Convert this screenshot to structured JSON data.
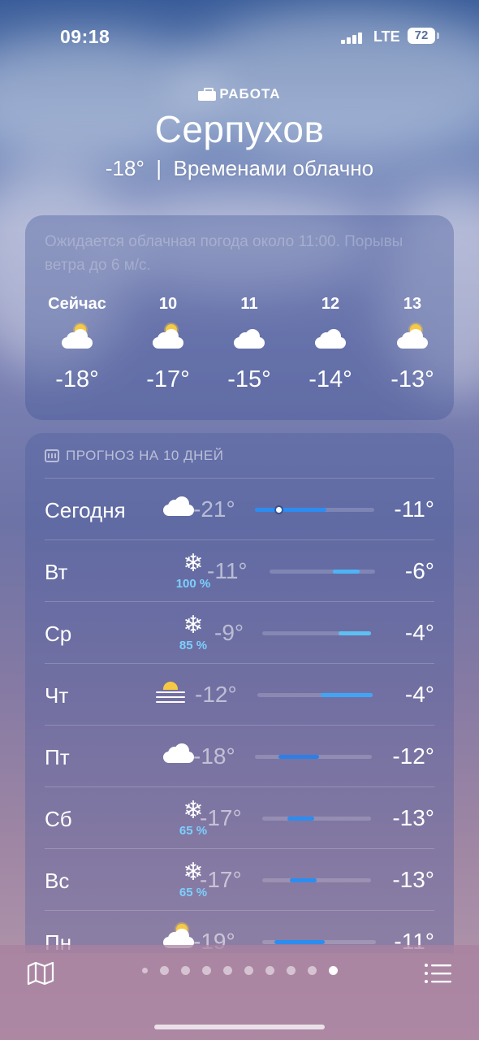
{
  "status_bar": {
    "time": "09:18",
    "network": "LTE",
    "battery": "72"
  },
  "location": {
    "tag": "РАБОТА",
    "city": "Серпухов",
    "summary": "-18°  |  Временами облачно"
  },
  "hourly": {
    "note": "Ожидается облачная погода около 11:00. Порывы ветра до 6 м/с.",
    "items": [
      {
        "label": "Сейчас",
        "icon": "sun-behind-cloud-icon",
        "temp": "-18°"
      },
      {
        "label": "10",
        "icon": "sun-behind-cloud-icon",
        "temp": "-17°"
      },
      {
        "label": "11",
        "icon": "cloud-icon",
        "temp": "-15°"
      },
      {
        "label": "12",
        "icon": "cloud-icon",
        "temp": "-14°"
      },
      {
        "label": "13",
        "icon": "sun-behind-cloud-icon",
        "temp": "-13°"
      }
    ]
  },
  "forecast": {
    "title": "ПРОГНОЗ НА 10 ДНЕЙ",
    "days": [
      {
        "day": "Сегодня",
        "icon": "cloud-icon",
        "precip": "",
        "low": "-21°",
        "high": "-11°",
        "range_start": 0.0,
        "range_end": 0.6,
        "current_marker": 0.2
      },
      {
        "day": "Вт",
        "icon": "snowflake-icon",
        "precip": "100 %",
        "low": "-11°",
        "high": "-6°",
        "range_start": 0.6,
        "range_end": 0.85
      },
      {
        "day": "Ср",
        "icon": "snowflake-icon",
        "precip": "85 %",
        "low": "-9°",
        "high": "-4°",
        "range_start": 0.7,
        "range_end": 1.0
      },
      {
        "day": "Чт",
        "icon": "sun-fog-icon",
        "precip": "",
        "low": "-12°",
        "high": "-4°",
        "range_start": 0.55,
        "range_end": 1.0
      },
      {
        "day": "Пт",
        "icon": "cloud-icon",
        "precip": "",
        "low": "-18°",
        "high": "-12°",
        "range_start": 0.2,
        "range_end": 0.55
      },
      {
        "day": "Сб",
        "icon": "snowflake-icon",
        "precip": "65 %",
        "low": "-17°",
        "high": "-13°",
        "range_start": 0.23,
        "range_end": 0.48
      },
      {
        "day": "Вс",
        "icon": "snowflake-icon",
        "precip": "65 %",
        "low": "-17°",
        "high": "-13°",
        "range_start": 0.25,
        "range_end": 0.5
      },
      {
        "day": "Пн",
        "icon": "sun-behind-cloud-icon",
        "precip": "",
        "low": "-19°",
        "high": "-11°",
        "range_start": 0.11,
        "range_end": 0.55
      }
    ]
  },
  "pager": {
    "count": 10,
    "active": 9
  }
}
